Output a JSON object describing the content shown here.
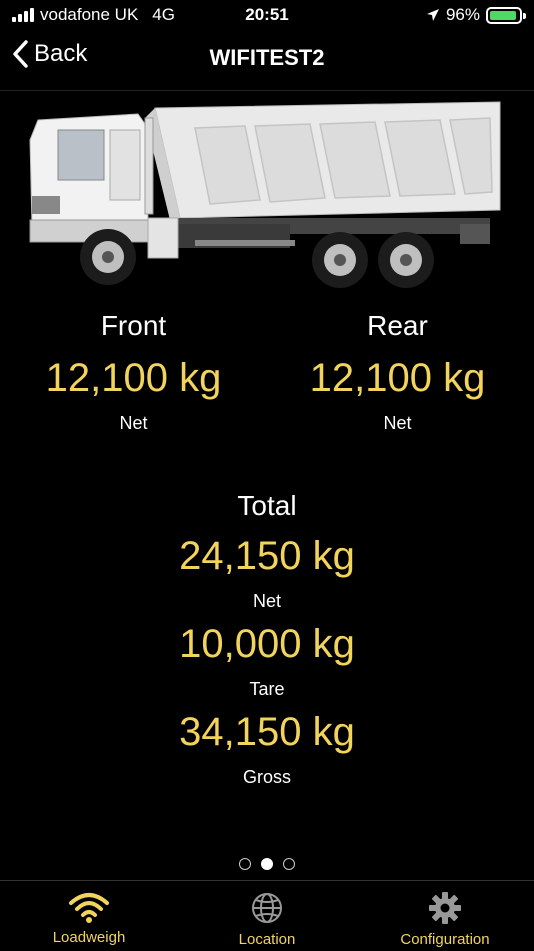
{
  "status_bar": {
    "carrier": "vodafone UK",
    "network": "4G",
    "time": "20:51",
    "battery": "96%",
    "battery_color": "#4cd964"
  },
  "nav": {
    "back_label": "Back",
    "title": "WIFITEST2"
  },
  "axles": {
    "front": {
      "label": "Front",
      "value": "12,100 kg",
      "sub": "Net"
    },
    "rear": {
      "label": "Rear",
      "value": "12,100 kg",
      "sub": "Net"
    }
  },
  "total": {
    "label": "Total",
    "net_value": "24,150 kg",
    "net_label": "Net",
    "tare_value": "10,000 kg",
    "tare_label": "Tare",
    "gross_value": "34,150 kg",
    "gross_label": "Gross"
  },
  "colors": {
    "accent": "#f2d45c"
  },
  "tabs": [
    {
      "label": "Loadweigh",
      "icon": "wifi-icon",
      "active": true
    },
    {
      "label": "Location",
      "icon": "globe-icon",
      "active": false
    },
    {
      "label": "Configuration",
      "icon": "gear-icon",
      "active": false
    }
  ]
}
